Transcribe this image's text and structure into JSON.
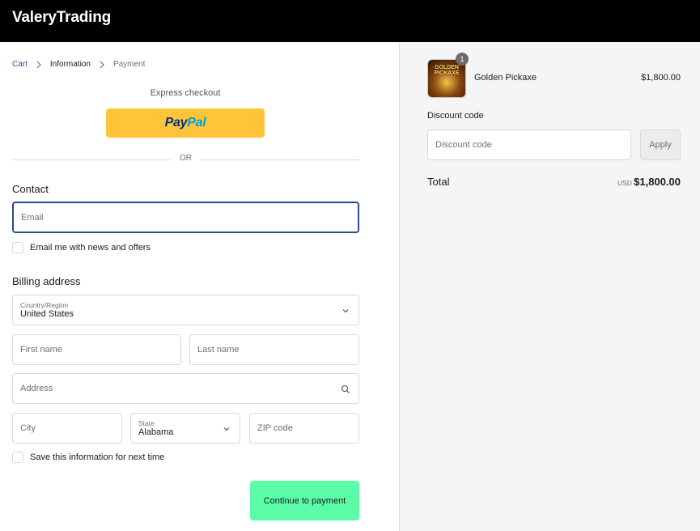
{
  "brand": {
    "name": "ValeryTrading"
  },
  "breadcrumb": {
    "cart": "Cart",
    "information": "Information",
    "payment": "Payment"
  },
  "express": {
    "title": "Express checkout",
    "paypal_part1": "Pay",
    "paypal_part2": "Pal",
    "or": "OR"
  },
  "contact": {
    "heading": "Contact",
    "email_placeholder": "Email",
    "newsletter_label": "Email me with news and offers"
  },
  "billing": {
    "heading": "Billing address",
    "country_label": "Country/Region",
    "country_value": "United States",
    "first_name_placeholder": "First name",
    "last_name_placeholder": "Last name",
    "address_placeholder": "Address",
    "city_placeholder": "City",
    "state_label": "State",
    "state_value": "Alabama",
    "zip_placeholder": "ZIP code",
    "save_info_label": "Save this information for next time",
    "continue_label": "Continue to payment"
  },
  "summary": {
    "product": {
      "name": "Golden Pickaxe",
      "price": "$1,800.00",
      "quantity": "1",
      "thumb_text_line1": "GOLDEN",
      "thumb_text_line2": "PICKAXE"
    },
    "discount_label": "Discount code",
    "discount_placeholder": "Discount code",
    "apply_label": "Apply",
    "total_label": "Total",
    "currency": "USD",
    "total_amount": "$1,800.00"
  },
  "colors": {
    "accent": "#2b4c8c",
    "continue": "#5bfca8",
    "paypal": "#ffc439",
    "header": "#000000"
  }
}
